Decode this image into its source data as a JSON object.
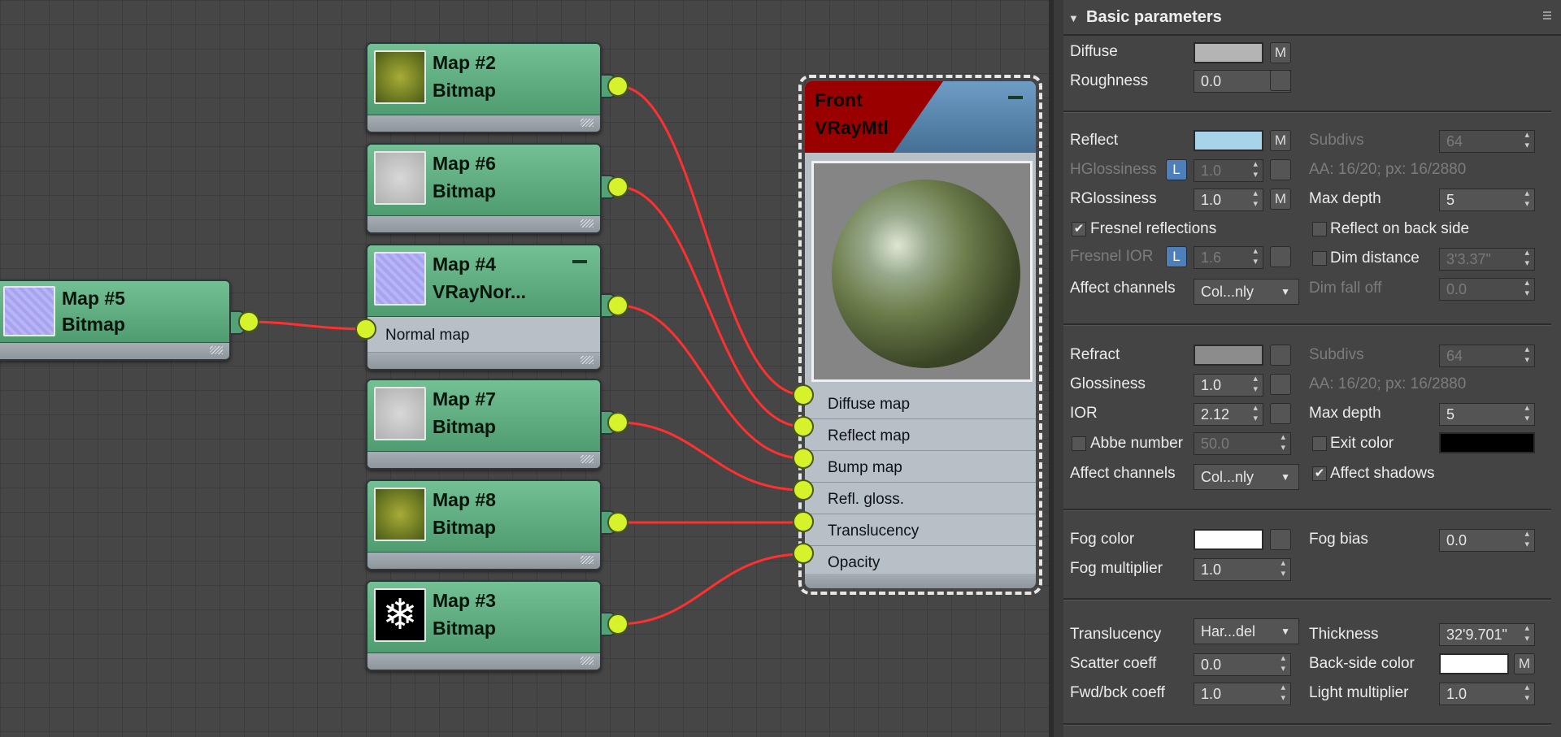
{
  "nodes": {
    "map5": {
      "name": "Map #5",
      "type": "Bitmap"
    },
    "map2": {
      "name": "Map #2",
      "type": "Bitmap"
    },
    "map6": {
      "name": "Map #6",
      "type": "Bitmap"
    },
    "map4": {
      "name": "Map #4",
      "type": "VRayNor...",
      "slot": "Normal map"
    },
    "map7": {
      "name": "Map #7",
      "type": "Bitmap"
    },
    "map8": {
      "name": "Map #8",
      "type": "Bitmap"
    },
    "map3": {
      "name": "Map #3",
      "type": "Bitmap"
    }
  },
  "material": {
    "name": "Front",
    "type": "VRayMtl",
    "slots": [
      "Diffuse map",
      "Reflect map",
      "Bump map",
      "Refl. gloss.",
      "Translucency",
      "Opacity"
    ]
  },
  "panel": {
    "title": "Basic parameters",
    "m": "M",
    "l": "L",
    "diffuse": {
      "label": "Diffuse",
      "color": "#b4b4b4"
    },
    "roughness": {
      "label": "Roughness",
      "value": "0.0"
    },
    "reflect": {
      "label": "Reflect",
      "color": "#a8d4ea",
      "subdivs_label": "Subdivs",
      "subdivs": "64"
    },
    "hgloss": {
      "label": "HGlossiness",
      "value": "1.0",
      "aa": "AA: 16/20; px: 16/2880"
    },
    "rgloss": {
      "label": "RGlossiness",
      "value": "1.0",
      "maxdepth_label": "Max depth",
      "maxdepth": "5"
    },
    "fresnel": {
      "label": "Fresnel reflections",
      "backside": "Reflect on back side"
    },
    "fresnel_ior": {
      "label": "Fresnel IOR",
      "value": "1.6",
      "dimdist_label": "Dim distance",
      "dimdist": "3'3.37\""
    },
    "affect1": {
      "label": "Affect channels",
      "value": "Col...nly",
      "dimfall_label": "Dim fall off",
      "dimfall": "0.0"
    },
    "refract": {
      "label": "Refract",
      "color": "#8c8c8c",
      "subdivs_label": "Subdivs",
      "subdivs": "64"
    },
    "glossiness": {
      "label": "Glossiness",
      "value": "1.0",
      "aa": "AA: 16/20; px: 16/2880"
    },
    "ior": {
      "label": "IOR",
      "value": "2.12",
      "maxdepth_label": "Max depth",
      "maxdepth": "5"
    },
    "abbe": {
      "label": "Abbe number",
      "value": "50.0",
      "exit_label": "Exit color",
      "exit_color": "#000000"
    },
    "affect2": {
      "label": "Affect channels",
      "value": "Col...nly",
      "shadows": "Affect shadows"
    },
    "fog": {
      "label": "Fog color",
      "color": "#ffffff",
      "bias_label": "Fog bias",
      "bias": "0.0"
    },
    "fogmult": {
      "label": "Fog multiplier",
      "value": "1.0"
    },
    "transl": {
      "label": "Translucency",
      "value": "Har...del",
      "thick_label": "Thickness",
      "thick": "32'9.701\""
    },
    "scatter": {
      "label": "Scatter coeff",
      "value": "0.0",
      "back_label": "Back-side color",
      "back_color": "#ffffff"
    },
    "fwd": {
      "label": "Fwd/bck coeff",
      "value": "1.0",
      "light_label": "Light multiplier",
      "light": "1.0"
    }
  }
}
